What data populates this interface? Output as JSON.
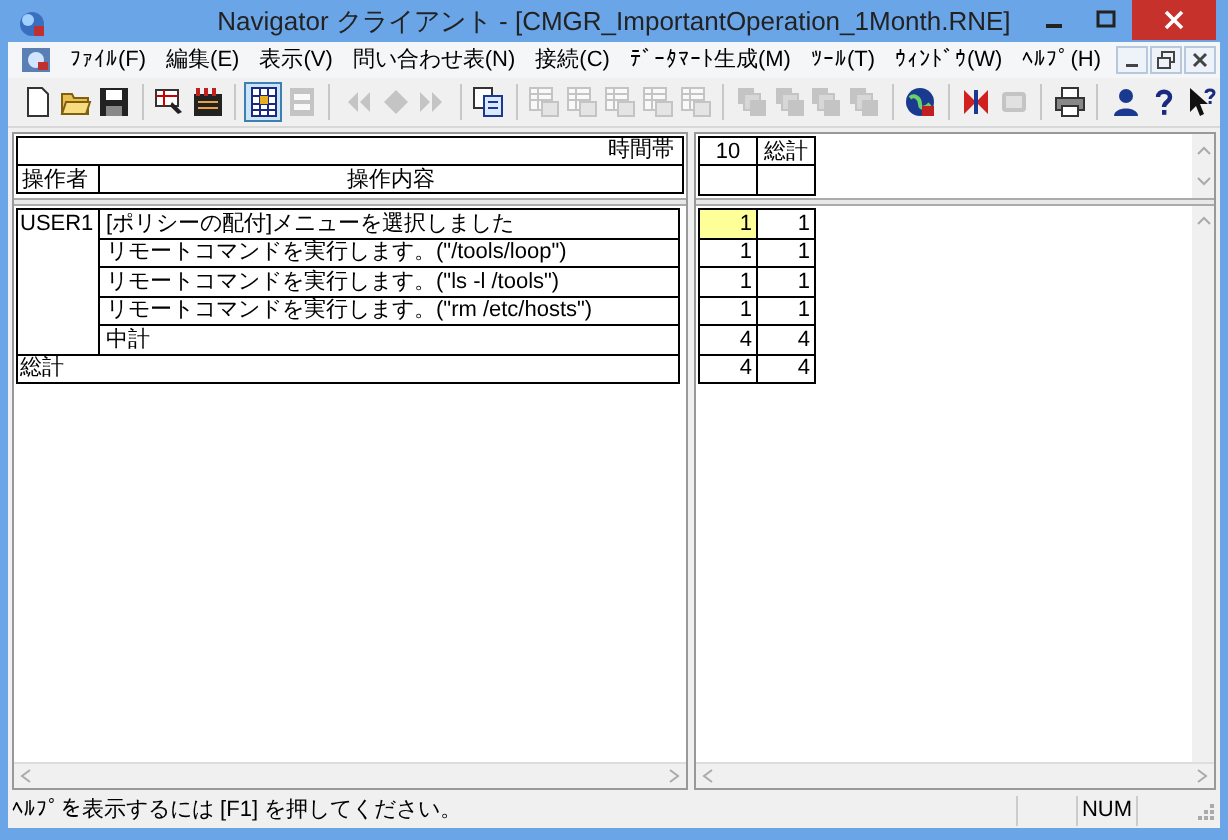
{
  "window": {
    "title": "Navigator クライアント - [CMGR_ImportantOperation_1Month.RNE]"
  },
  "menu": [
    {
      "label": "ﾌｧｲﾙ(F)"
    },
    {
      "label": "編集(E)"
    },
    {
      "label": "表示(V)"
    },
    {
      "label": "問い合わせ表(N)"
    },
    {
      "label": "接続(C)"
    },
    {
      "label": "ﾃﾞｰﾀﾏｰﾄ生成(M)"
    },
    {
      "label": "ﾂｰﾙ(T)"
    },
    {
      "label": "ｳｨﾝﾄﾞｳ(W)"
    },
    {
      "label": "ﾍﾙﾌﾟ(H)"
    }
  ],
  "toolbar": [
    [
      {
        "kind": "new",
        "disabled": false,
        "selected": false
      },
      {
        "kind": "open",
        "disabled": false,
        "selected": false
      },
      {
        "kind": "save",
        "disabled": false,
        "selected": false
      }
    ],
    [
      {
        "kind": "properties",
        "disabled": false,
        "selected": false
      },
      {
        "kind": "calendar",
        "disabled": false,
        "selected": false
      }
    ],
    [
      {
        "kind": "grid",
        "disabled": false,
        "selected": true
      },
      {
        "kind": "form",
        "disabled": true,
        "selected": false
      }
    ],
    [
      {
        "kind": "first",
        "disabled": true,
        "selected": false
      },
      {
        "kind": "diamond",
        "disabled": true,
        "selected": false
      },
      {
        "kind": "last",
        "disabled": true,
        "selected": false
      }
    ],
    [
      {
        "kind": "copy",
        "disabled": false,
        "selected": false
      }
    ],
    [
      {
        "kind": "table",
        "disabled": true,
        "selected": false
      },
      {
        "kind": "table",
        "disabled": true,
        "selected": false
      },
      {
        "kind": "table",
        "disabled": true,
        "selected": false
      },
      {
        "kind": "table",
        "disabled": true,
        "selected": false
      },
      {
        "kind": "table",
        "disabled": true,
        "selected": false
      }
    ],
    [
      {
        "kind": "stack",
        "disabled": true,
        "selected": false
      },
      {
        "kind": "stack",
        "disabled": true,
        "selected": false
      },
      {
        "kind": "stack",
        "disabled": true,
        "selected": false
      },
      {
        "kind": "stack",
        "disabled": true,
        "selected": false
      }
    ],
    [
      {
        "kind": "globe",
        "disabled": false,
        "selected": false
      }
    ],
    [
      {
        "kind": "butterfly",
        "disabled": false,
        "selected": false
      },
      {
        "kind": "panel",
        "disabled": true,
        "selected": false
      }
    ],
    [
      {
        "kind": "print",
        "disabled": false,
        "selected": false
      }
    ],
    [
      {
        "kind": "person",
        "disabled": false,
        "selected": false
      },
      {
        "kind": "help",
        "disabled": false,
        "selected": false
      },
      {
        "kind": "context_help",
        "disabled": false,
        "selected": false
      }
    ]
  ],
  "grid": {
    "band_label": "時間帯",
    "columns": [
      "操作者",
      "操作内容"
    ],
    "value_columns": [
      "10",
      "総計"
    ],
    "groups": [
      {
        "operator": "USER1",
        "rows": [
          {
            "operation": "[ポリシーの配付]メニューを選択しました",
            "values": [
              {
                "text": "1",
                "selected": true
              },
              {
                "text": "1",
                "selected": false
              }
            ]
          },
          {
            "operation": "リモートコマンドを実行します。(\"/tools/loop\")",
            "values": [
              {
                "text": "1",
                "selected": false
              },
              {
                "text": "1",
                "selected": false
              }
            ]
          },
          {
            "operation": "リモートコマンドを実行します。(\"ls -l /tools\")",
            "values": [
              {
                "text": "1",
                "selected": false
              },
              {
                "text": "1",
                "selected": false
              }
            ]
          },
          {
            "operation": "リモートコマンドを実行します。(\"rm /etc/hosts\")",
            "values": [
              {
                "text": "1",
                "selected": false
              },
              {
                "text": "1",
                "selected": false
              }
            ]
          }
        ],
        "subtotal": {
          "label": "中計",
          "values": [
            {
              "text": "4",
              "selected": false
            },
            {
              "text": "4",
              "selected": false
            }
          ]
        }
      }
    ],
    "total": {
      "label": "総計",
      "values": [
        {
          "text": "4",
          "selected": false
        },
        {
          "text": "4",
          "selected": false
        }
      ]
    }
  },
  "status_bar": {
    "message": "ﾍﾙﾌﾟを表示するには [F1] を押してください。",
    "indicators": [
      "NUM"
    ]
  }
}
